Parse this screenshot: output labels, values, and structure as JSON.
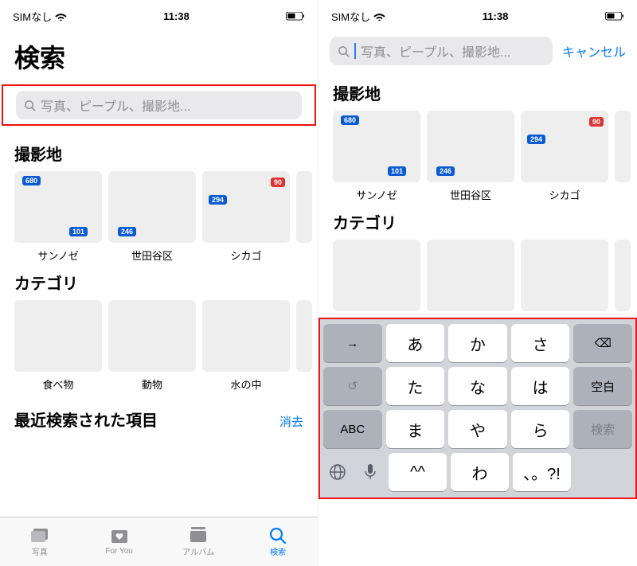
{
  "status": {
    "sim": "SIMなし",
    "time": "11:38"
  },
  "left": {
    "title": "検索",
    "placeholder": "写真、ピープル、撮影地...",
    "section_places": "撮影地",
    "places": [
      {
        "label": "サンノゼ",
        "shield": "680",
        "shield2": "101"
      },
      {
        "label": "世田谷区",
        "shield": "246"
      },
      {
        "label": "シカゴ",
        "shield": "294",
        "shield2": "90"
      }
    ],
    "section_categories": "カテゴリ",
    "categories": [
      {
        "label": "食べ物"
      },
      {
        "label": "動物"
      },
      {
        "label": "水の中"
      }
    ],
    "recent_title": "最近検索された項目",
    "clear": "消去",
    "tabs": [
      {
        "label": "写真"
      },
      {
        "label": "For You"
      },
      {
        "label": "アルバム"
      },
      {
        "label": "検索"
      }
    ]
  },
  "right": {
    "placeholder": "写真、ピープル、撮影地...",
    "cancel": "キャンセル",
    "section_places": "撮影地",
    "places": [
      {
        "label": "サンノゼ",
        "shield": "680",
        "shield2": "101"
      },
      {
        "label": "世田谷区",
        "shield": "246"
      },
      {
        "label": "シカゴ",
        "shield": "294",
        "shield2": "90"
      }
    ],
    "section_categories": "カテゴリ",
    "keyboard": {
      "rows": [
        [
          "→",
          "あ",
          "か",
          "さ",
          "⌫"
        ],
        [
          "↺",
          "た",
          "な",
          "は",
          "空白"
        ],
        [
          "ABC",
          "ま",
          "や",
          "ら",
          "検索"
        ],
        [
          "",
          "^^",
          "わ",
          "、。?!",
          ""
        ]
      ],
      "globe": "🌐",
      "mic": "🎤"
    }
  }
}
